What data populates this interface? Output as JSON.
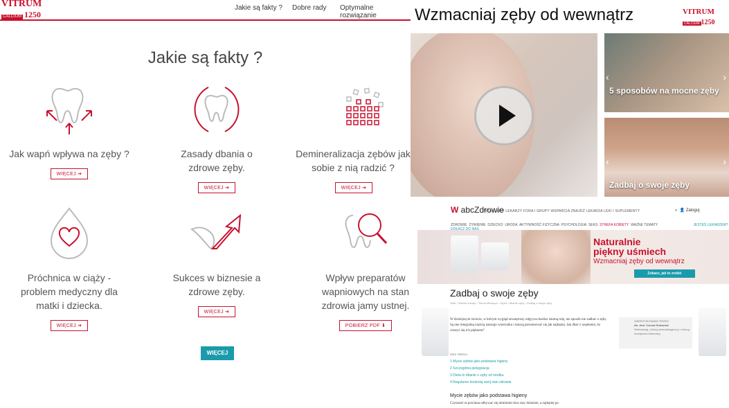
{
  "left": {
    "logo": {
      "brand": "VITRUM",
      "sub": "CALCIUM",
      "num": "1250"
    },
    "nav": [
      "Jakie są fakty ?",
      "Dobre rady",
      "Optymalne rozwiązanie"
    ],
    "heading": "Jakie są fakty ?",
    "cards": [
      {
        "title": "Jak wapń wpływa na zęby ?",
        "button": "WIĘCEJ",
        "icon": "tooth-arrows-icon"
      },
      {
        "title": "Zasady dbania o zdrowe zęby.",
        "button": "WIĘCEJ",
        "icon": "tooth-circle-icon"
      },
      {
        "title": "Demineralizacja zębów jak sobie z nią radzić ?",
        "button": "WIĘCEJ",
        "icon": "demineralization-icon"
      },
      {
        "title": "Próchnica w ciąży - problem medyczny dla matki i dziecka.",
        "button": "WIĘCEJ",
        "icon": "drop-heart-icon"
      },
      {
        "title": "Sukces w biznesie a zdrowe zęby.",
        "button": "WIĘCEJ",
        "icon": "growth-arrow-icon"
      },
      {
        "title": "Wpływ preparatów wapniowych na stan zdrowia jamy ustnej.",
        "button": "POBIERZ PDF",
        "icon": "tooth-magnifier-icon"
      }
    ],
    "more": "WIĘCEJ"
  },
  "right": {
    "title": "Wzmacniaj zęby od wewnątrz",
    "thumbs": [
      {
        "label": "5 sposobów na mocne zęby"
      },
      {
        "label": "Zadbaj o swoje zęby"
      }
    ],
    "site": {
      "brand_pre": "abc",
      "brand_main": "Zdrowie",
      "menu1": "PYTANIA DO LEKARZY   FORA I GRUPY WSPARCIA   ZNAJDŹ LEKARZA   LEKI I SUPLEMENTY",
      "login": "Zaloguj",
      "menu2": [
        "ZDROWIE",
        "ŻYWIENIE",
        "DZIECKO",
        "URODA",
        "AKTYWNOŚĆ FIZYCZNA",
        "PSYCHOLOGIA",
        "SEKS",
        "STREFA KOBIETY",
        "WAŻNE TEMATY"
      ],
      "menu2_right": "JESTEŚ LEKARZEM? DOŁĄCZ DO NAS",
      "banner_title1": "Naturalnie",
      "banner_title2": "piękny uśmiech",
      "banner_sub": "Wzmacniaj zęby od wewnątrz",
      "banner_btn": "Zobacz, jak to zrobić",
      "article_title": "Zadbaj o swoje zęby",
      "crumb": "Start  ›  Ważne tematy  ›  Temat Miesiąca - Mycie i dbanie zęby  ›  Zadbaj o swoje zęby",
      "body": "W dzisiejszym świecie, w którym wygląd zewnętrzny odgrywa bardzo istotną rolę, nie sposób nie zadbać o zęby. Są one integralną częścią naszego wizerunku i muszą prezentować się jak najlepiej. Jak dbać o uzębienie, by cieszyć się ich pięknem?",
      "reviewer_label": "ZWERYFIKOWANY PRZEZ:",
      "reviewer_name": "lek. dent. Konrad Rutkowski",
      "reviewer_desc": "Stomatolog, chirurg stomatologiczny i chirurg szczękowo-twarzowy.",
      "toc_title": "SPIS TREŚCI",
      "toc": [
        "1  Mycie zębów jako podstawa higieny",
        "2  Szczególna pielęgnacja",
        "3  Dieta to dbanie o zęby od środka",
        "4  Regularne kontroluj swój stan zdrowia"
      ],
      "sub": "Mycie zębów jako podstawa higieny",
      "sub_text": "Czynność ta powinna odbywać się minimum dwa razy dziennie, a najlepiej po"
    }
  }
}
